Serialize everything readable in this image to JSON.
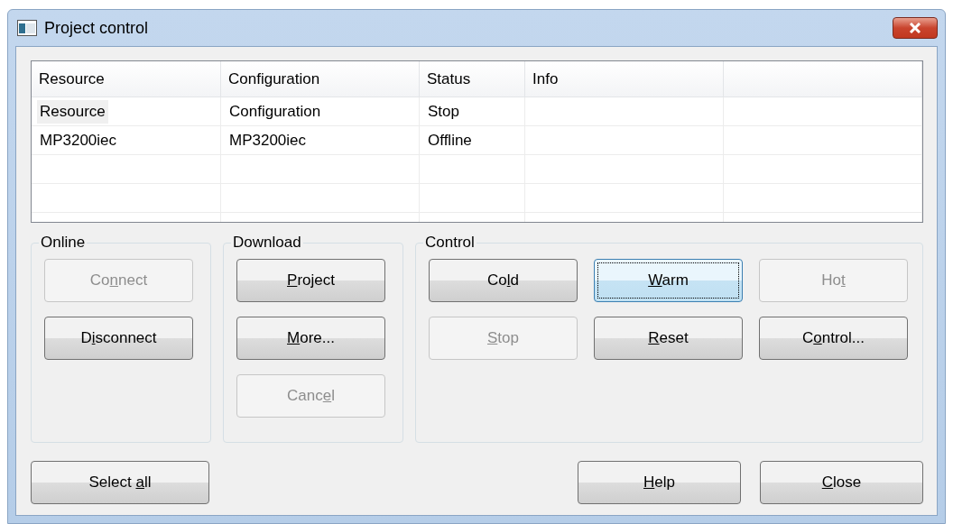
{
  "window": {
    "title": "Project control"
  },
  "table": {
    "columns": [
      "Resource",
      "Configuration",
      "Status",
      "Info"
    ],
    "rows": [
      {
        "selected": true,
        "cells": [
          "Resource",
          "Configuration",
          "Stop",
          ""
        ]
      },
      {
        "selected": false,
        "cells": [
          "MP3200iec",
          "MP3200iec",
          "Offline",
          ""
        ]
      }
    ]
  },
  "groups": [
    {
      "label": "Online",
      "buttons": [
        {
          "before": "Co",
          "mnemonic": "n",
          "after": "nect",
          "disabled": true,
          "focused": false
        },
        {
          "before": "D",
          "mnemonic": "i",
          "after": "sconnect",
          "disabled": false,
          "focused": false
        }
      ]
    },
    {
      "label": "Download",
      "buttons": [
        {
          "mnemonic": "P",
          "after": "roject",
          "disabled": false,
          "focused": false
        },
        {
          "mnemonic": "M",
          "after": "ore...",
          "disabled": false,
          "focused": false
        },
        {
          "before": "Canc",
          "mnemonic": "e",
          "after": "l",
          "disabled": true,
          "focused": false
        }
      ]
    },
    {
      "label": "Control",
      "buttons": [
        {
          "before": "Co",
          "mnemonic": "l",
          "after": "d",
          "disabled": false,
          "focused": false
        },
        {
          "mnemonic": "W",
          "after": "arm",
          "disabled": false,
          "focused": true
        },
        {
          "before": "Ho",
          "mnemonic": "t",
          "disabled": true,
          "focused": false
        },
        {
          "mnemonic": "S",
          "after": "top",
          "disabled": true,
          "focused": false
        },
        {
          "mnemonic": "R",
          "after": "eset",
          "disabled": false,
          "focused": false
        },
        {
          "before": "C",
          "mnemonic": "o",
          "after": "ntrol...",
          "disabled": false,
          "focused": false
        }
      ]
    }
  ],
  "footer": {
    "left": [
      {
        "before": "Select ",
        "mnemonic": "a",
        "after": "ll",
        "disabled": false,
        "focused": false
      }
    ],
    "right": [
      {
        "mnemonic": "H",
        "after": "elp",
        "disabled": false,
        "focused": false
      },
      {
        "mnemonic": "C",
        "after": "lose",
        "disabled": false,
        "focused": false
      }
    ]
  }
}
